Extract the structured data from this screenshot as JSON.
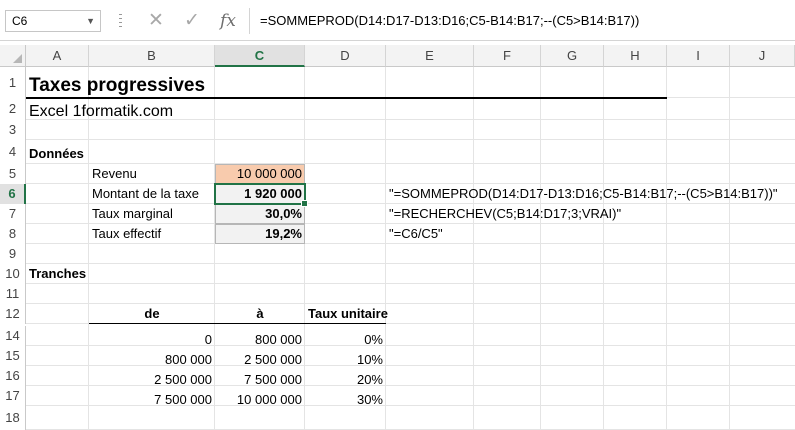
{
  "formula_bar": {
    "name_box": "C6",
    "cancel_icon": "✕",
    "enter_icon": "✓",
    "fx_label": "fx",
    "formula": "=SOMMEPROD(D14:D17-D13:D16;C5-B14:B17;--(C5>B14:B17))"
  },
  "columns": [
    "A",
    "B",
    "C",
    "D",
    "E",
    "F",
    "G",
    "H",
    "I",
    "J"
  ],
  "selected_column": "C",
  "rows": [
    "1",
    "2",
    "3",
    "4",
    "5",
    "6",
    "7",
    "8",
    "9",
    "10",
    "11",
    "12",
    "14",
    "15",
    "16",
    "17",
    "18"
  ],
  "selected_row": "6",
  "colors": {
    "accent": "#217346",
    "revenue_fill": "#f8cbad",
    "input_fill": "#f2f2f2"
  },
  "sheet": {
    "title": "Taxes progressives",
    "subtitle": "Excel 1formatik.com",
    "donnees_label": "Données",
    "revenu_label": "Revenu",
    "revenu_value": "10 000 000",
    "montant_label": "Montant de la taxe",
    "montant_value": "1 920 000",
    "montant_formula": "\"=SOMMEPROD(D14:D17-D13:D16;C5-B14:B17;--(C5>B14:B17))\"",
    "taux_marginal_label": "Taux marginal",
    "taux_marginal_value": "30,0%",
    "taux_marginal_formula": "\"=RECHERCHEV(C5;B14:D17;3;VRAI)\"",
    "taux_effectif_label": "Taux effectif",
    "taux_effectif_value": "19,2%",
    "taux_effectif_formula": "\"=C6/C5\"",
    "tranches_label": "Tranches",
    "table": {
      "headers": [
        "de",
        "à",
        "Taux unitaire"
      ],
      "rows": [
        [
          "0",
          "800 000",
          "0%"
        ],
        [
          "800 000",
          "2 500 000",
          "10%"
        ],
        [
          "2 500 000",
          "7 500 000",
          "20%"
        ],
        [
          "7 500 000",
          "10 000 000",
          "30%"
        ]
      ]
    }
  }
}
